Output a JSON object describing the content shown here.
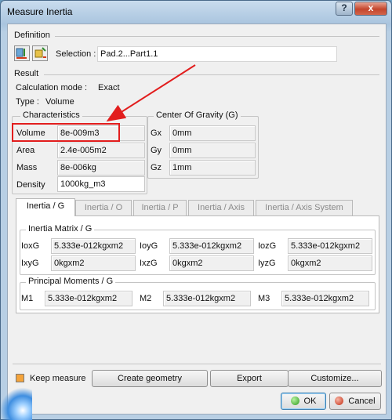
{
  "window": {
    "title": "Measure Inertia",
    "help_button": "?",
    "close_button": "x"
  },
  "definition": {
    "label": "Definition",
    "selection_label": "Selection :",
    "selection_value": "Pad.2...Part1.1"
  },
  "result": {
    "label": "Result",
    "calc_mode_label": "Calculation mode :",
    "calc_mode_value": "Exact",
    "type_label": "Type :",
    "type_value": "Volume"
  },
  "characteristics": {
    "title": "Characteristics",
    "rows": [
      {
        "label": "Volume",
        "value": "8e-009m3"
      },
      {
        "label": "Area",
        "value": "2.4e-005m2"
      },
      {
        "label": "Mass",
        "value": "8e-006kg"
      },
      {
        "label": "Density",
        "value": "1000kg_m3"
      }
    ]
  },
  "center_of_gravity": {
    "title": "Center Of Gravity (G)",
    "rows": [
      {
        "label": "Gx",
        "value": "0mm"
      },
      {
        "label": "Gy",
        "value": "0mm"
      },
      {
        "label": "Gz",
        "value": "1mm"
      }
    ]
  },
  "tabs": [
    {
      "label": "Inertia / G",
      "active": true
    },
    {
      "label": "Inertia / O",
      "active": false
    },
    {
      "label": "Inertia / P",
      "active": false
    },
    {
      "label": "Inertia / Axis",
      "active": false
    },
    {
      "label": "Inertia / Axis System",
      "active": false
    }
  ],
  "inertia_matrix": {
    "title": "Inertia Matrix / G",
    "row1": [
      {
        "label": "IoxG",
        "value": "5.333e-012kgxm2"
      },
      {
        "label": "IoyG",
        "value": "5.333e-012kgxm2"
      },
      {
        "label": "IozG",
        "value": "5.333e-012kgxm2"
      }
    ],
    "row2": [
      {
        "label": "IxyG",
        "value": "0kgxm2"
      },
      {
        "label": "IxzG",
        "value": "0kgxm2"
      },
      {
        "label": "IyzG",
        "value": "0kgxm2"
      }
    ]
  },
  "principal_moments": {
    "title": "Principal Moments / G",
    "row": [
      {
        "label": "M1",
        "value": "5.333e-012kgxm2"
      },
      {
        "label": "M2",
        "value": "5.333e-012kgxm2"
      },
      {
        "label": "M3",
        "value": "5.333e-012kgxm2"
      }
    ]
  },
  "bottom": {
    "keep_measure_label": "Keep measure",
    "create_geometry": "Create geometry",
    "export": "Export",
    "customize": "Customize...",
    "ok": "OK",
    "cancel": "Cancel"
  },
  "colors": {
    "highlight": "#e21d1d",
    "arrow": "#e21d1d",
    "title_bar": "#a9c4de"
  }
}
